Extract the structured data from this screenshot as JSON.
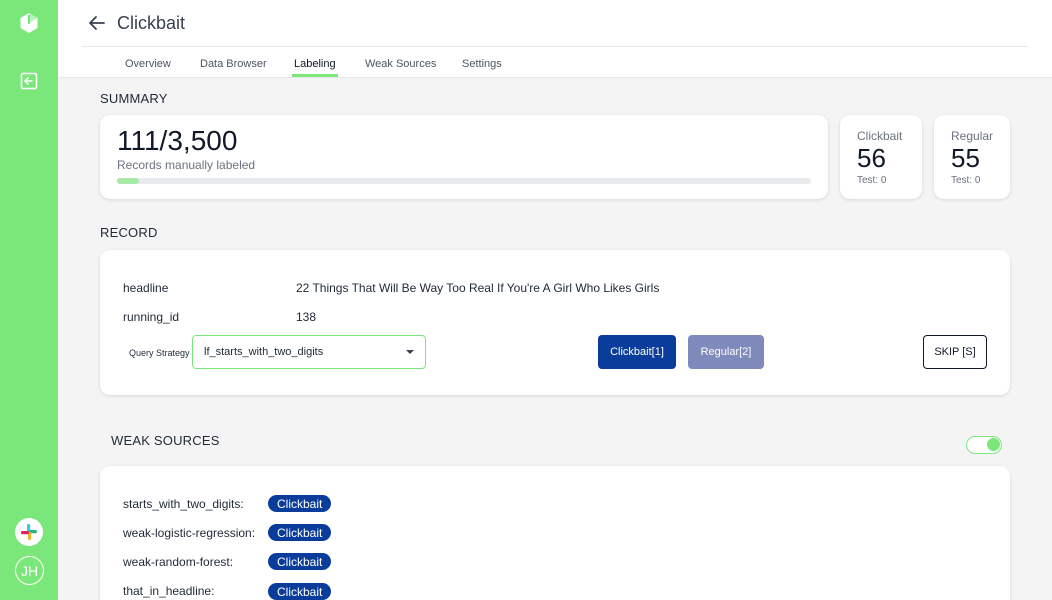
{
  "app": {
    "title": "Clickbait",
    "avatar_initials": "JH",
    "accent_color": "#7be77b",
    "primary_button_color": "#0a3d9b"
  },
  "tabs": [
    {
      "label": "Overview",
      "active": false
    },
    {
      "label": "Data Browser",
      "active": false
    },
    {
      "label": "Labeling",
      "active": true
    },
    {
      "label": "Weak Sources",
      "active": false
    },
    {
      "label": "Settings",
      "active": false
    }
  ],
  "summary": {
    "heading": "SUMMARY",
    "count": "111/3,500",
    "caption": "Records manually labeled",
    "progress_fraction": 0.0317,
    "labels": [
      {
        "name": "Clickbait",
        "value": "56",
        "test": "Test: 0"
      },
      {
        "name": "Regular",
        "value": "55",
        "test": "Test: 0"
      }
    ]
  },
  "record": {
    "heading": "RECORD",
    "fields": [
      {
        "key": "headline",
        "value": "22 Things That Will Be Way Too Real If You're A Girl Who Likes Girls"
      },
      {
        "key": "running_id",
        "value": "138"
      }
    ],
    "query_strategy_label": "Query Strategy",
    "query_strategy_value": "lf_starts_with_two_digits",
    "buttons": {
      "clickbait": "Clickbait[1]",
      "regular": "Regular[2]",
      "skip": "SKIP [S]"
    }
  },
  "weak_sources": {
    "heading": "WEAK SOURCES",
    "toggle_on": true,
    "items": [
      {
        "name": "starts_with_two_digits:",
        "label": "Clickbait"
      },
      {
        "name": "weak-logistic-regression:",
        "label": "Clickbait"
      },
      {
        "name": "weak-random-forest:",
        "label": "Clickbait"
      },
      {
        "name": "that_in_headline:",
        "label": "Clickbait"
      }
    ]
  },
  "icons": {
    "logo": "app-logo-icon",
    "nav": "labeling-nav-icon",
    "back": "back-arrow-icon",
    "slack": "slack-icon",
    "caret": "caret-down-icon"
  }
}
